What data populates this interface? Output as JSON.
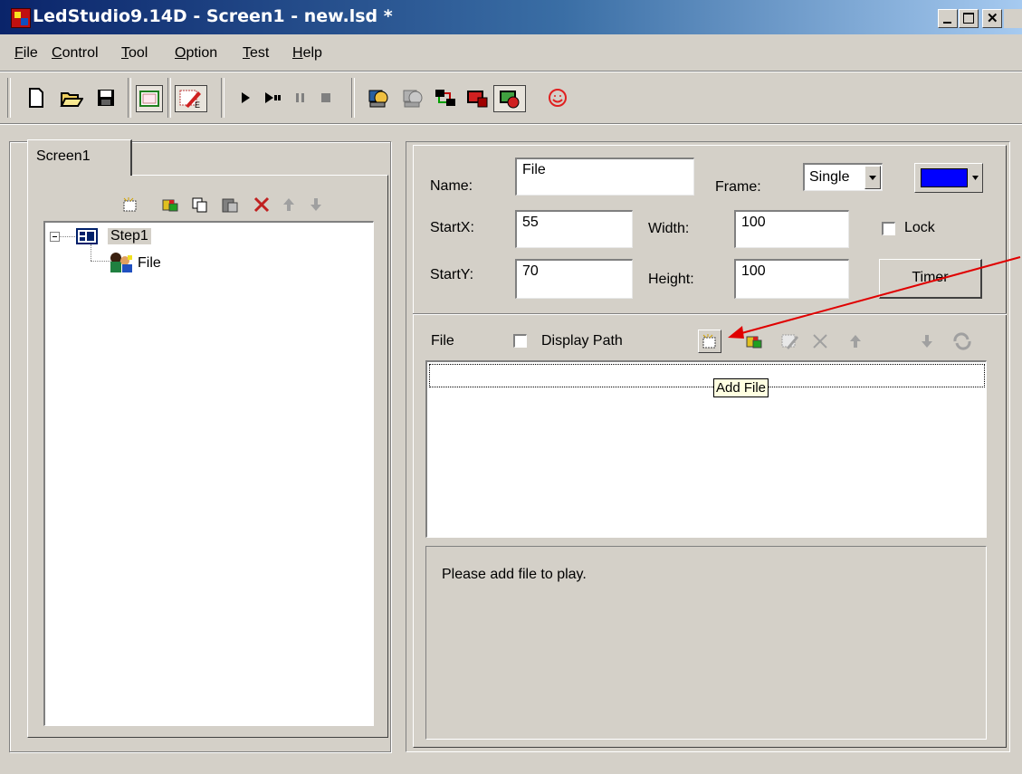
{
  "window": {
    "title": "LedStudio9.14D - Screen1 - new.lsd *"
  },
  "menu": [
    {
      "prefix": "",
      "key": "F",
      "rest": "ile"
    },
    {
      "prefix": "",
      "key": "C",
      "rest": "ontrol"
    },
    {
      "prefix": "",
      "key": "T",
      "rest": "ool"
    },
    {
      "prefix": "",
      "key": "O",
      "rest": "ption"
    },
    {
      "prefix": "",
      "key": "T",
      "rest": "est"
    },
    {
      "prefix": "",
      "key": "H",
      "rest": "elp"
    }
  ],
  "toolbar": {
    "icons": [
      "new-icon",
      "open-icon",
      "save-icon",
      "screen-icon",
      "edit-icon",
      "play-icon",
      "step-play-icon",
      "pause-icon",
      "stop-icon",
      "network-icon",
      "network-disabled-icon",
      "connect-icon",
      "lock-screen-icon",
      "display-icon",
      "smiley-icon"
    ]
  },
  "left": {
    "tab_label": "Screen1",
    "tree": {
      "root_label": "Step1",
      "child_label": "File"
    }
  },
  "props": {
    "name_label": "Name:",
    "name_value": "File",
    "frame_label": "Frame:",
    "frame_value": "Single",
    "frame_color": "#0000ff",
    "startx_label": "StartX:",
    "startx_value": "55",
    "width_label": "Width:",
    "width_value": "100",
    "lock_label": "Lock",
    "starty_label": "StartY:",
    "starty_value": "70",
    "height_label": "Height:",
    "height_value": "100",
    "timer_label": "Timer"
  },
  "files": {
    "label": "File",
    "display_path_label": "Display Path",
    "tooltip": "Add File",
    "status": "Please add file to play."
  },
  "annotation": {
    "arrow_color": "#e00000"
  }
}
